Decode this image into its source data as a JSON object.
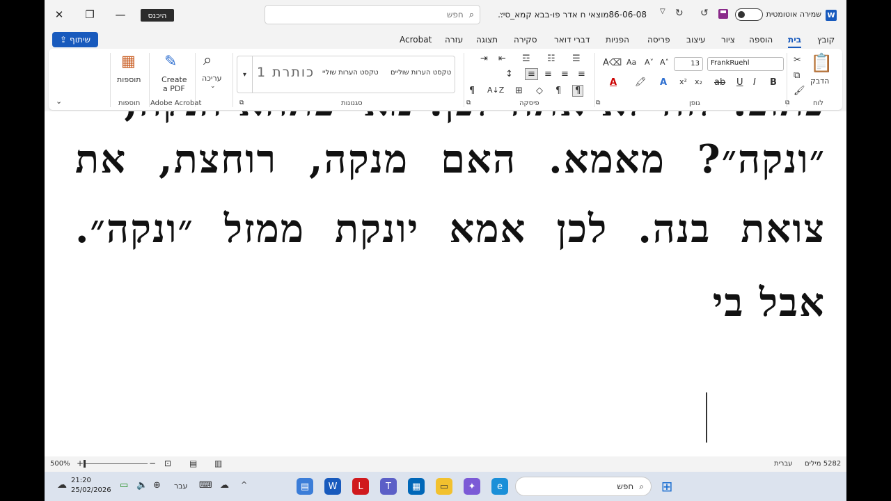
{
  "titlebar": {
    "signin_label": "היכנס",
    "search_placeholder": "חפש",
    "doc_title": "86-06-08מוצאי ח אדר פו-בבא קמא_סי...",
    "autosave_label": "שמירה אוטומטית",
    "word_icon": "W"
  },
  "tabs": {
    "share_label": "שיתוף",
    "items": [
      "קובץ",
      "בית",
      "הוספה",
      "ציור",
      "עיצוב",
      "פריסה",
      "הפניות",
      "דברי דואר",
      "סקירה",
      "תצוגה",
      "עזרה",
      "Acrobat"
    ]
  },
  "ribbon": {
    "clipboard": {
      "paste_label": "הדבק",
      "group_label": "לוח"
    },
    "font": {
      "name": "FrankRuehl",
      "size": "13",
      "group_label": "גופן"
    },
    "paragraph": {
      "group_label": "פיסקה"
    },
    "styles": {
      "items": [
        "טקסט הערות שוליים",
        "טקסט הערות שוליי",
        "כותרת 1"
      ],
      "group_label": "סגנונות"
    },
    "editing": {
      "label": "עריכה"
    },
    "acrobat": {
      "label_line1": "Create",
      "label_line2": "a PDF",
      "group_label": "Adobe Acrobat"
    },
    "addins": {
      "label": "תוספות",
      "group_label": "תוספות"
    }
  },
  "document": {
    "line1": "כתוב: לזה לא אתה לכן. מאי פתחא הנקה,",
    "line2_words": [
      "״ונקה״?",
      "מאמא.",
      "האם",
      "מנקה,",
      "רוחצת,",
      "את"
    ],
    "line3_words": [
      "צואת",
      "בנה.",
      "לכן",
      "אמא",
      "יונקת",
      "ממזל",
      "״ונקה״."
    ],
    "line4": "אבל בי"
  },
  "statusbar": {
    "zoom": "500%",
    "language": "עברית",
    "word_count": "5282 מילים"
  },
  "taskbar": {
    "search_label": "חפש",
    "language": "עבר",
    "time": "21:20",
    "date": "25/02/2026"
  }
}
